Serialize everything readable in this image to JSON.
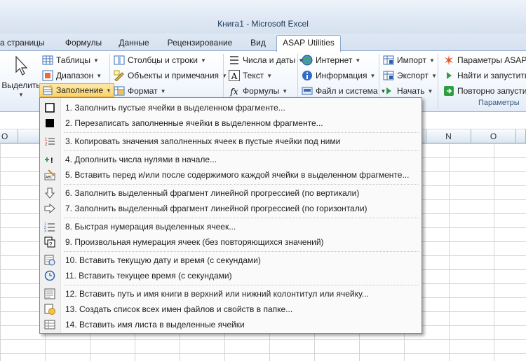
{
  "window": {
    "title": "Книга1  -  Microsoft Excel"
  },
  "tabs": [
    {
      "label": "а страницы"
    },
    {
      "label": "Формулы"
    },
    {
      "label": "Данные"
    },
    {
      "label": "Рецензирование"
    },
    {
      "label": "Вид"
    },
    {
      "label": "ASAP Utilities"
    }
  ],
  "ribbon": {
    "select_label": "Выделить",
    "col1": [
      "Таблицы",
      "Диапазон",
      "Заполнение"
    ],
    "col2": [
      "Столбцы и строки",
      "Объекты и примечания",
      "Формат"
    ],
    "col3": [
      "Числа и даты",
      "Текст",
      "Формулы"
    ],
    "col4": [
      "Интернет",
      "Информация",
      "Файл и система"
    ],
    "col5": [
      "Импорт",
      "Экспорт",
      "Начать"
    ],
    "col6": [
      "Параметры ASAP U",
      "Найти и запустить",
      "Повторно запусти"
    ],
    "group_label": "Параметры"
  },
  "sheet": {
    "columns": [
      "O",
      "N",
      "O"
    ]
  },
  "menu": {
    "items": [
      {
        "label": "1. Заполнить пустые ячейки в выделенном фрагменте...",
        "icon": "empty-square-icon"
      },
      {
        "label": "2. Перезаписать заполненные ячейки в выделенном фрагменте...",
        "icon": "filled-square-icon"
      },
      {
        "label": "3. Копировать значения заполненных ячеек в пустые ячейки под ними",
        "icon": "list-numbers-icon"
      },
      {
        "label": "4. Дополнить числа нулями в начале...",
        "icon": "add-zeros-icon"
      },
      {
        "label": "5. Вставить перед и/или после содержимого каждой ячейки в выделенном фрагменте...",
        "icon": "insert-text-icon"
      },
      {
        "label": "6. Заполнить выделенный фрагмент линейной прогрессией (по вертикали)",
        "icon": "arrow-down-icon"
      },
      {
        "label": "7. Заполнить выделенный фрагмент линейной прогрессией (по горизонтали)",
        "icon": "arrow-right-icon"
      },
      {
        "label": "8. Быстрая нумерация выделенных ячеек...",
        "icon": "numbering-icon"
      },
      {
        "label": "9. Произвольная нумерация ячеек (без повторяющихся значений)",
        "icon": "random-numbering-icon"
      },
      {
        "label": "10. Вставить текущую дату и время (с секундами)",
        "icon": "date-time-icon"
      },
      {
        "label": "11. Вставить текущее время (с секундами)",
        "icon": "clock-icon"
      },
      {
        "label": "12. Вставить путь и имя книги в верхний или нижний колонтитул или ячейку...",
        "icon": "path-icon"
      },
      {
        "label": "13. Создать список всех имен файлов и свойств в папке...",
        "icon": "folder-list-icon"
      },
      {
        "label": "14. Вставить имя листа в выделенные ячейки",
        "icon": "sheet-name-icon"
      }
    ]
  }
}
